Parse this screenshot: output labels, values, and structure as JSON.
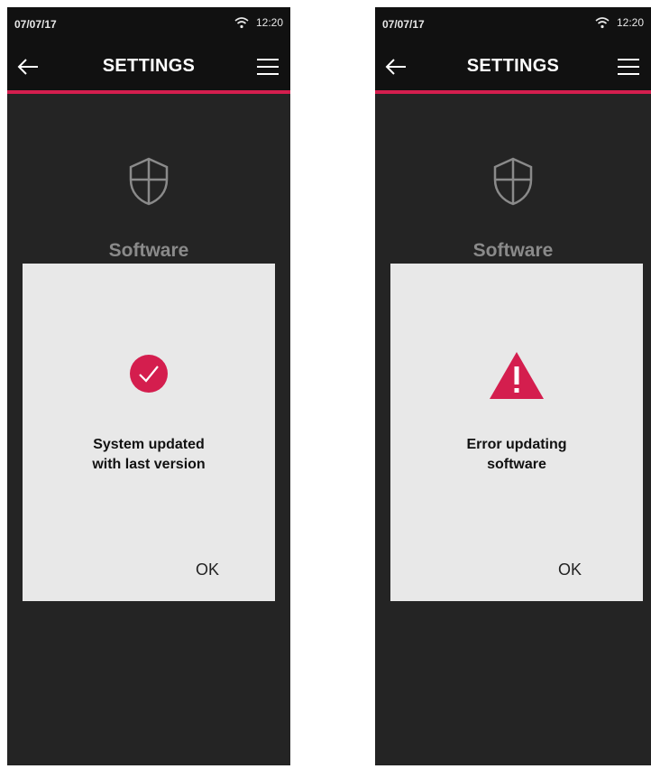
{
  "screens": [
    {
      "status": {
        "date": "07/07/17",
        "time": "12:20"
      },
      "app_bar": {
        "title": "SETTINGS"
      },
      "page": {
        "heading": "Software"
      },
      "dialog": {
        "icon": "check-circle-icon",
        "message_line1": "System updated",
        "message_line2": "with last version",
        "ok_label": "OK"
      }
    },
    {
      "status": {
        "date": "07/07/17",
        "time": "12:20"
      },
      "app_bar": {
        "title": "SETTINGS"
      },
      "page": {
        "heading": "Software"
      },
      "dialog": {
        "icon": "warning-triangle-icon",
        "message_line1": "Error updating",
        "message_line2": "software",
        "ok_label": "OK"
      }
    }
  ],
  "colors": {
    "accent": "#d41e4e",
    "background": "#242424",
    "bar": "#111111",
    "dialog": "#e8e8e8"
  }
}
